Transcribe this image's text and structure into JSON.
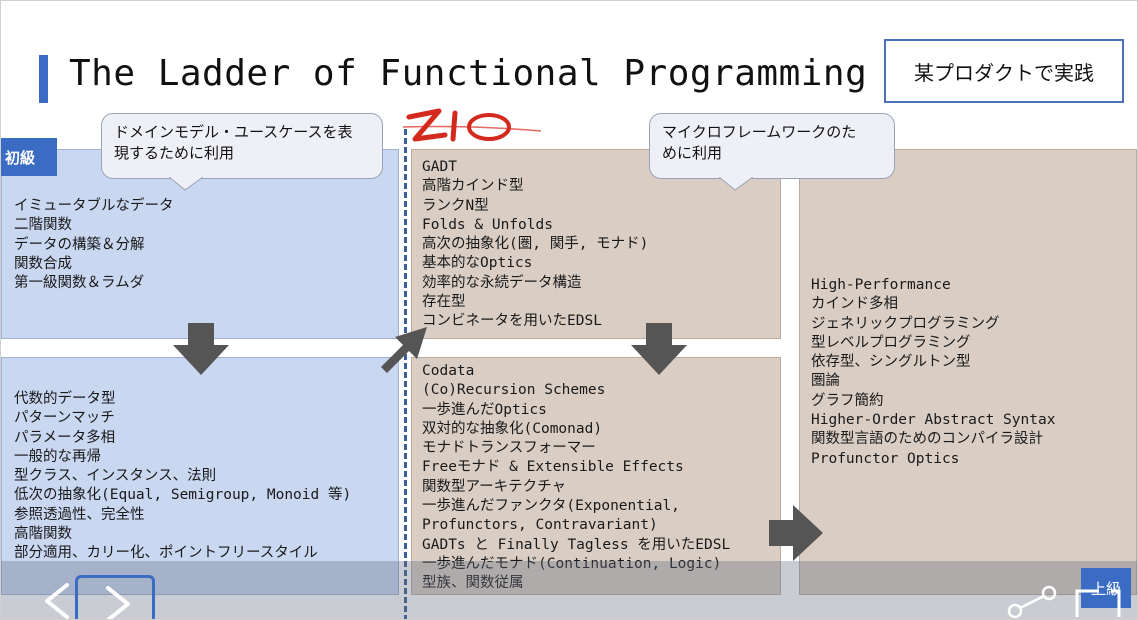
{
  "title": "The Ladder of Functional Programming",
  "practice_box": "某プロダクトで実践",
  "beginner_label": "初級",
  "advanced_label": "上級",
  "callouts": {
    "left": [
      "ドメインモデル・ユースケースを表",
      "現するために利用"
    ],
    "right": [
      "マイクロフレームワークのた",
      "めに利用"
    ]
  },
  "logo_text": "ZIO",
  "panels": {
    "beginner_top": [
      "イミュータブルなデータ",
      "二階関数",
      "データの構築＆分解",
      "関数合成",
      "第一級関数＆ラムダ"
    ],
    "beginner_bottom": [
      "代数的データ型",
      "パターンマッチ",
      "パラメータ多相",
      "一般的な再帰",
      "型クラス、インスタンス、法則",
      "低次の抽象化(Equal, Semigroup, Monoid 等)",
      "参照透過性、完全性",
      "高階関数",
      "部分適用、カリー化、ポイントフリースタイル"
    ],
    "intermediate_top": [
      "GADT",
      "高階カインド型",
      "ランクN型",
      "Folds & Unfolds",
      "高次の抽象化(圏, 関手, モナド)",
      "基本的なOptics",
      "効率的な永続データ構造",
      "存在型",
      "コンビネータを用いたEDSL"
    ],
    "intermediate_bottom": [
      "Codata",
      "(Co)Recursion Schemes",
      "一歩進んだOptics",
      "双対的な抽象化(Comonad)",
      "モナドトランスフォーマー",
      "Freeモナド & Extensible Effects",
      "関数型アーキテクチャ",
      "一歩進んだファンクタ(Exponential,",
      "Profunctors, Contravariant)",
      "GADTs と Finally Tagless を用いたEDSL",
      "一歩進んだモナド(Continuation, Logic)",
      "型族、関数従属"
    ],
    "advanced": [
      "High-Performance",
      "カインド多相",
      "ジェネリックプログラミング",
      "型レベルプログラミング",
      "依存型、シングルトン型",
      "圏論",
      "グラフ簡約",
      "Higher-Order Abstract Syntax",
      "関数型言語のためのコンパイラ設計",
      "Profunctor Optics"
    ]
  },
  "colors": {
    "accent": "#3b6cc4",
    "beginner_panel": "#c9d7f1",
    "upper_panel": "#d9cdc4",
    "arrow": "#555555",
    "zio_red": "#d42a1e"
  },
  "icons": {
    "down_arrow_1": "down-arrow-icon",
    "diag_arrow": "diagonal-arrow-icon",
    "down_arrow_2": "down-arrow-icon",
    "right_arrow": "right-arrow-icon",
    "prev": "chevron-left-icon",
    "next": "chevron-right-icon",
    "share": "share-icon",
    "corner": "fullscreen-corner-icon"
  }
}
